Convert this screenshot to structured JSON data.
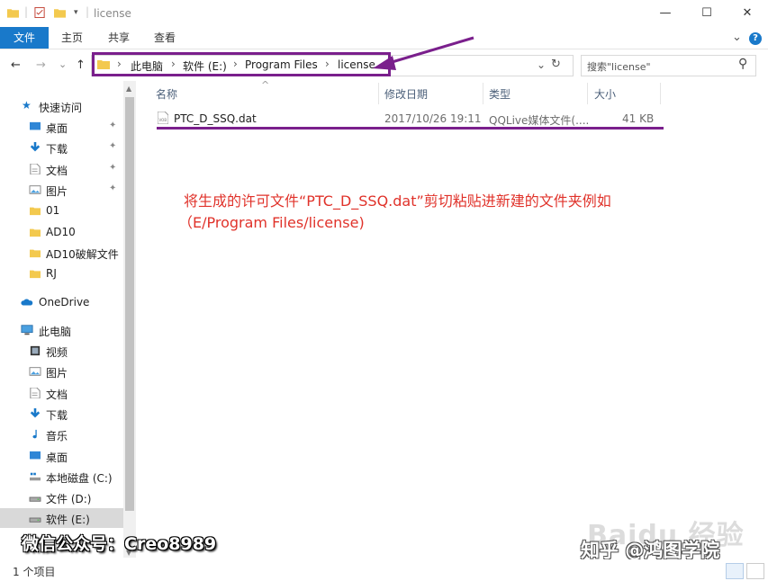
{
  "window": {
    "title": "license",
    "minimize": "—",
    "maximize": "☐",
    "close": "✕"
  },
  "ribbon": {
    "tabs": [
      "文件",
      "主页",
      "共享",
      "查看"
    ],
    "chevron": "⌄",
    "help": "?"
  },
  "nav": {
    "back": "←",
    "forward": "→",
    "recent": "⌄",
    "up": "↑",
    "breadcrumbs": [
      "此电脑",
      "软件 (E:)",
      "Program Files",
      "license"
    ],
    "separator": "›",
    "dropdown": "⌄",
    "refresh": "↻",
    "search_placeholder": "搜索\"license\"",
    "search_icon": "⚲"
  },
  "sidebar": {
    "quick_access": "快速访问",
    "quick_items": [
      {
        "label": "桌面",
        "icon": "desktop-icon",
        "pinned": true
      },
      {
        "label": "下载",
        "icon": "download-icon",
        "pinned": true
      },
      {
        "label": "文档",
        "icon": "document-icon",
        "pinned": true
      },
      {
        "label": "图片",
        "icon": "picture-icon",
        "pinned": true
      },
      {
        "label": "01",
        "icon": "folder-icon",
        "pinned": false
      },
      {
        "label": "AD10",
        "icon": "folder-icon",
        "pinned": false
      },
      {
        "label": "AD10破解文件",
        "icon": "folder-icon",
        "pinned": false
      },
      {
        "label": "RJ",
        "icon": "folder-icon",
        "pinned": false
      }
    ],
    "onedrive": "OneDrive",
    "this_pc": "此电脑",
    "pc_items": [
      {
        "label": "视频",
        "icon": "video-icon"
      },
      {
        "label": "图片",
        "icon": "picture-icon"
      },
      {
        "label": "文档",
        "icon": "document-icon"
      },
      {
        "label": "下载",
        "icon": "download-icon"
      },
      {
        "label": "音乐",
        "icon": "music-icon"
      },
      {
        "label": "桌面",
        "icon": "desktop-icon"
      },
      {
        "label": "本地磁盘 (C:)",
        "icon": "windows-drive-icon"
      },
      {
        "label": "文件 (D:)",
        "icon": "drive-icon"
      },
      {
        "label": "软件 (E:)",
        "icon": "drive-icon",
        "selected": true
      }
    ],
    "pin_glyph": "📌"
  },
  "columns": {
    "name": "名称",
    "modified": "修改日期",
    "type": "类型",
    "size": "大小",
    "sort_arrow": "^"
  },
  "files": [
    {
      "name": "PTC_D_SSQ.dat",
      "modified": "2017/10/26 19:11",
      "type": "QQLive媒体文件(....",
      "size": "41 KB"
    }
  ],
  "annotation": {
    "line1": "将生成的许可文件“PTC_D_SSQ.dat”剪切粘贴进新建的文件夹例如",
    "line2": "（E/Program Files/license)"
  },
  "status": {
    "item_count": "1 个项目"
  },
  "watermarks": {
    "wechat": "微信公众号：Creo8989",
    "zhihu": "知乎 @鸿图学院",
    "baidu": "Baidu 经验"
  },
  "colors": {
    "accent": "#1979ca",
    "highlight": "#7a1f8c",
    "annotation": "#e0322a",
    "folder": "#f3c94e"
  }
}
